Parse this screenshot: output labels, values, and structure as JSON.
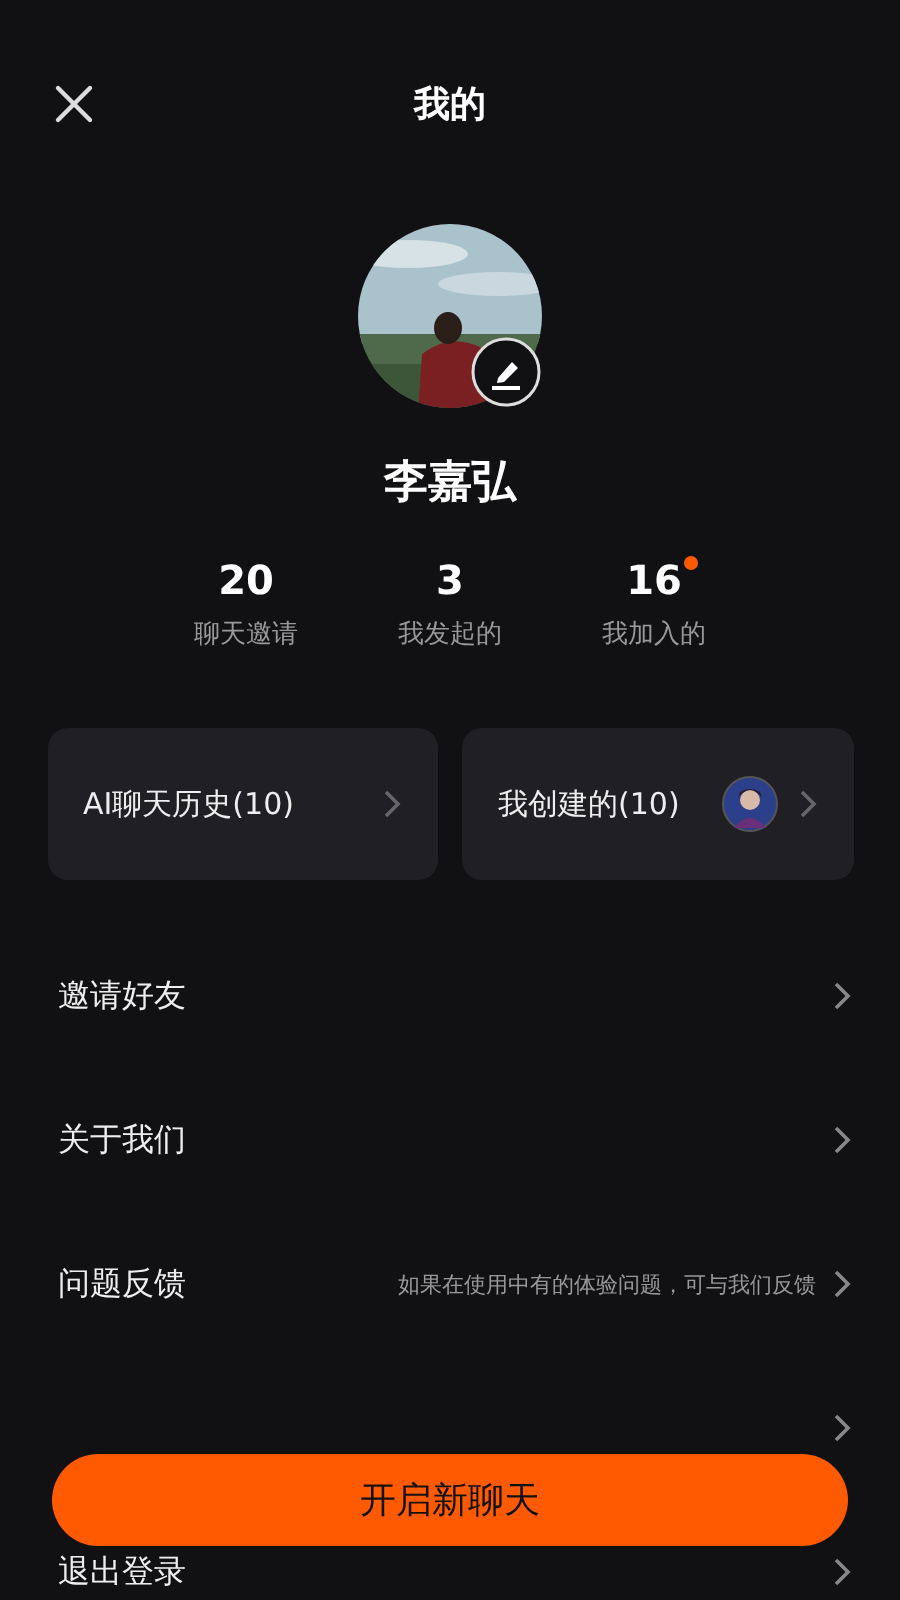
{
  "header": {
    "title": "我的"
  },
  "profile": {
    "name": "李嘉弘"
  },
  "stats": [
    {
      "value": "20",
      "label": "聊天邀请",
      "unread": false
    },
    {
      "value": "3",
      "label": "我发起的",
      "unread": false
    },
    {
      "value": "16",
      "label": "我加入的",
      "unread": true
    }
  ],
  "cards": [
    {
      "label": "AI聊天历史(10)",
      "kind": "plain"
    },
    {
      "label": "我创建的(10)",
      "kind": "avatar"
    }
  ],
  "menu": [
    {
      "label": "邀请好友"
    },
    {
      "label": "关于我们"
    },
    {
      "label": "问题反馈",
      "hint": "如果在使用中有的体验问题，可与我们反馈"
    },
    {
      "label": "退出登录"
    }
  ],
  "primary_button": {
    "label": "开启新聊天"
  }
}
